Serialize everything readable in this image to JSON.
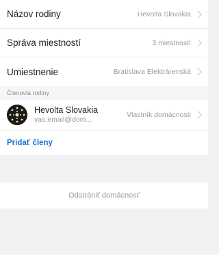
{
  "settings": [
    {
      "label": "Názov rodiny",
      "value": "Hevolta Slovakia"
    },
    {
      "label": "Správa miestností",
      "value": "3 miestností"
    },
    {
      "label": "Umiestnenie",
      "value": "Bratislava Elektrárenská"
    }
  ],
  "members_section": {
    "title": "Členovia rodiny",
    "member": {
      "name": "Hevolta Slovakia",
      "email": "vas.email@dom...",
      "role": "Vlastník domácnosti",
      "avatar_icon": "avatar-image"
    },
    "add_label": "Pridať členy"
  },
  "remove_label": "Odstrániť domácnosť",
  "colors": {
    "accent": "#1b6ed6",
    "background": "#f2f2f4"
  }
}
